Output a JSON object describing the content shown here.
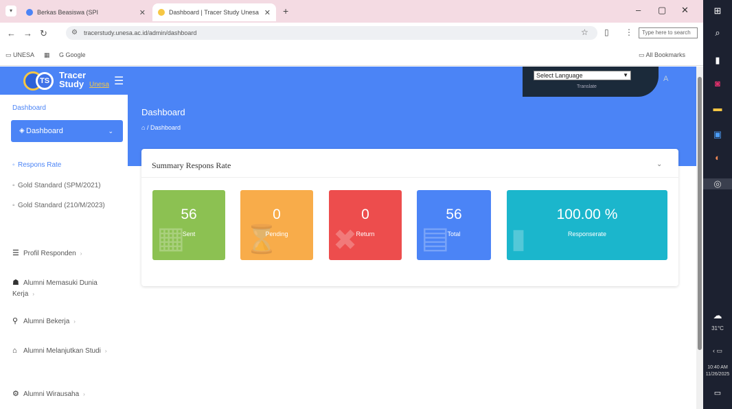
{
  "browser": {
    "tabs": [
      {
        "label": "Berkas Beasiswa (SPI",
        "active": false
      },
      {
        "label": "Dashboard | Tracer Study Unesa",
        "active": true
      }
    ],
    "new_tab": "+",
    "window": {
      "minimize": "–",
      "restore": "▢",
      "close": "✕"
    },
    "url": "tracerstudy.unesa.ac.id/admin/dashboard",
    "search_placeholder": "Type here to search",
    "bookmarks": [
      "UNESA",
      "Google"
    ],
    "all_bookmarks": "All Bookmarks",
    "accent": "#f4dbe3"
  },
  "app": {
    "logo": {
      "badge": "TS",
      "line1": "Tracer",
      "line2": "Study",
      "line3": "Unesa"
    },
    "language": {
      "selected": "Select Language",
      "powered": "Translate"
    },
    "header": {
      "title": "Dashboard",
      "breadcrumb": "Dashboard"
    },
    "primary_color": "#4b84f6"
  },
  "sidebar": {
    "section": "Dashboard",
    "active_item": "Dashboard",
    "subitems": [
      {
        "label": "Respons Rate",
        "active": true
      },
      {
        "label": "Gold Standard (SPM/2021)",
        "active": false
      },
      {
        "label": "Gold Standard (210/M/2023)",
        "active": false
      }
    ],
    "items": [
      {
        "label": "Profil Responden",
        "icon": "list-icon"
      },
      {
        "label": "Alumni Memasuki Dunia Kerja",
        "icon": "people-icon"
      },
      {
        "label": "Alumni Bekerja",
        "icon": "binoculars-icon"
      },
      {
        "label": "Alumni Melanjutkan Studi",
        "icon": "graduation-cap-icon"
      },
      {
        "label": "Alumni Wirausaha",
        "icon": "gears-icon"
      }
    ]
  },
  "summary": {
    "title": "Summary Respons Rate",
    "tiles": [
      {
        "value": "56",
        "label": "Sent",
        "color": "#8cc152"
      },
      {
        "value": "0",
        "label": "Pending",
        "color": "#f8ac4a"
      },
      {
        "value": "0",
        "label": "Return",
        "color": "#ed4d4d"
      },
      {
        "value": "56",
        "label": "Total",
        "color": "#4b84f6"
      },
      {
        "value": "100.00 %",
        "label": "Responserate",
        "color": "#1bb6cc"
      }
    ]
  },
  "taskbar": {
    "weather": "31°C",
    "time": "10:40 AM",
    "date": "11/26/2025"
  }
}
